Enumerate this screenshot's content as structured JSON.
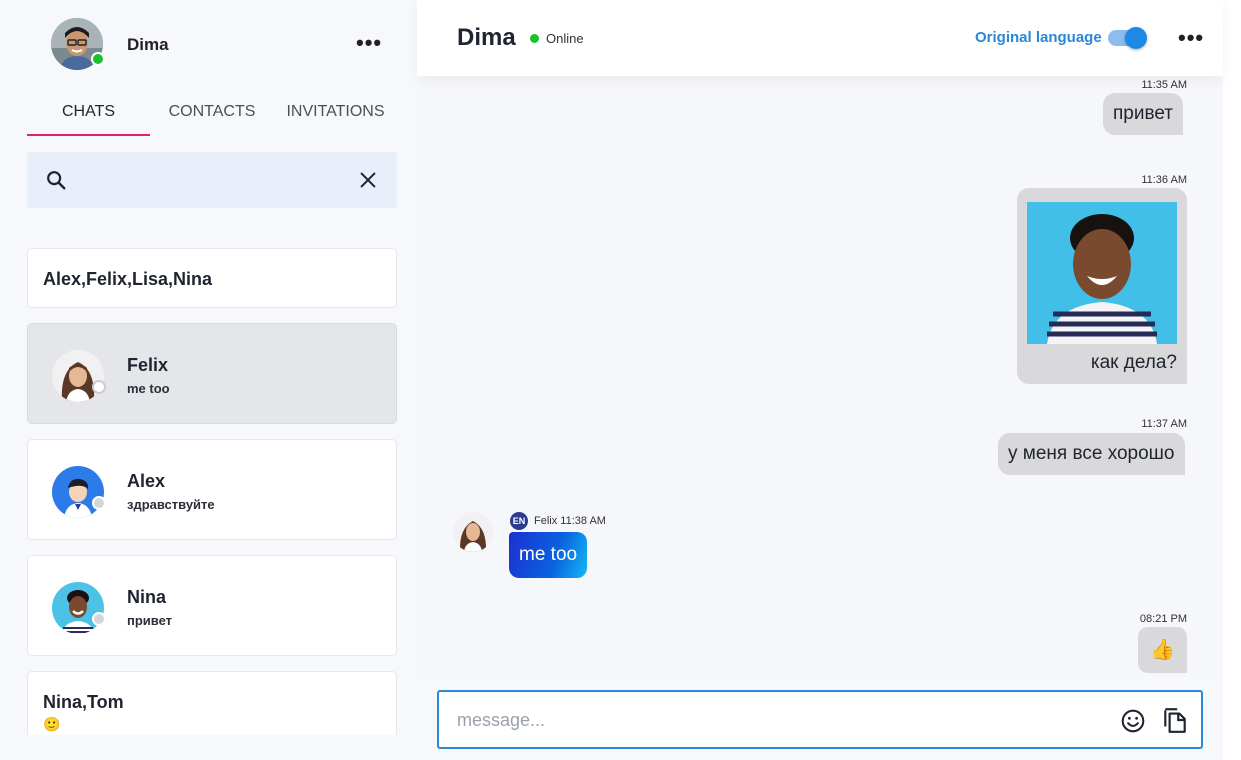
{
  "user": {
    "name": "Dima",
    "status_color": "#19c12f"
  },
  "sidebar": {
    "menu_icon": "more-horizontal-icon",
    "tabs": [
      {
        "label": "CHATS",
        "active": true
      },
      {
        "label": "CONTACTS",
        "active": false
      },
      {
        "label": "INVITATIONS",
        "active": false
      }
    ],
    "search": {
      "value": "",
      "placeholder": ""
    },
    "chats": [
      {
        "title": "Alex,Felix,Lisa,Nina",
        "group": true
      },
      {
        "name": "Felix",
        "last": "me too",
        "active": true
      },
      {
        "name": "Alex",
        "last": "здравствуйте"
      },
      {
        "name": "Nina",
        "last": "привет"
      },
      {
        "title": "Nina,Tom",
        "last": "🙂",
        "group": true
      }
    ]
  },
  "header": {
    "name": "Dima",
    "status": "Online",
    "language_toggle_label": "Original language",
    "language_toggle_on": true,
    "accent": "#2b87d8"
  },
  "messages": [
    {
      "dir": "out",
      "time": "11:35 AM",
      "text": "привет"
    },
    {
      "dir": "out",
      "time": "11:36 AM",
      "text": "как дела?",
      "has_image": true
    },
    {
      "dir": "out",
      "time": "11:37 AM",
      "text": "у меня все хорошо"
    },
    {
      "dir": "in",
      "sender": "Felix",
      "time": "11:38 AM",
      "lang": "EN",
      "text": "me too"
    },
    {
      "dir": "out",
      "time": "08:21 PM",
      "text": "👍"
    }
  ],
  "composer": {
    "placeholder": "message...",
    "value": ""
  }
}
